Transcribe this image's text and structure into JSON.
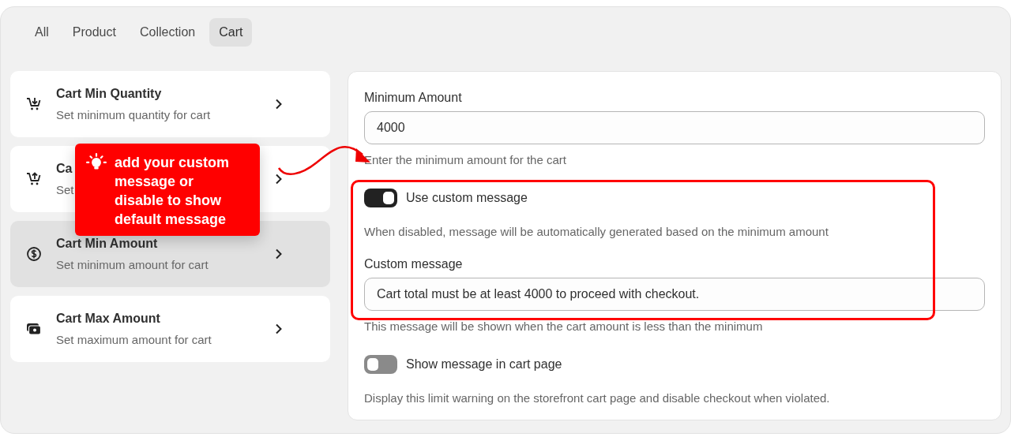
{
  "tabs": [
    {
      "label": "All",
      "selected": false
    },
    {
      "label": "Product",
      "selected": false
    },
    {
      "label": "Collection",
      "selected": false
    },
    {
      "label": "Cart",
      "selected": true
    }
  ],
  "rules": [
    {
      "kind": "cart-down",
      "title": "Cart Min Quantity",
      "subtitle": "Set minimum quantity for cart",
      "selected": false
    },
    {
      "kind": "cart-up",
      "title": "Ca",
      "subtitle": "Set",
      "selected": false
    },
    {
      "kind": "coin",
      "title": "Cart Min Amount",
      "subtitle": "Set minimum amount for cart",
      "selected": true
    },
    {
      "kind": "cash",
      "title": "Cart Max Amount",
      "subtitle": "Set maximum amount for cart",
      "selected": false
    }
  ],
  "settings": [
    {
      "kind": "field",
      "label": "Minimum Amount",
      "value": "4000",
      "help": "Enter the minimum amount for the cart"
    },
    {
      "kind": "toggle",
      "label": "Use custom message",
      "on": true,
      "help": "When disabled, message will be automatically generated based on the minimum amount"
    },
    {
      "kind": "field",
      "label": "Custom message",
      "value": "Cart total must be at least 4000 to proceed with checkout.",
      "help": "This message will be shown when the cart amount is less than the minimum"
    },
    {
      "kind": "toggle",
      "label": "Show message in cart page",
      "on": false,
      "help": "Display this limit warning on the storefront cart page and disable checkout when violated."
    }
  ],
  "callout": {
    "text": "add your custom message or disable to show default message"
  }
}
